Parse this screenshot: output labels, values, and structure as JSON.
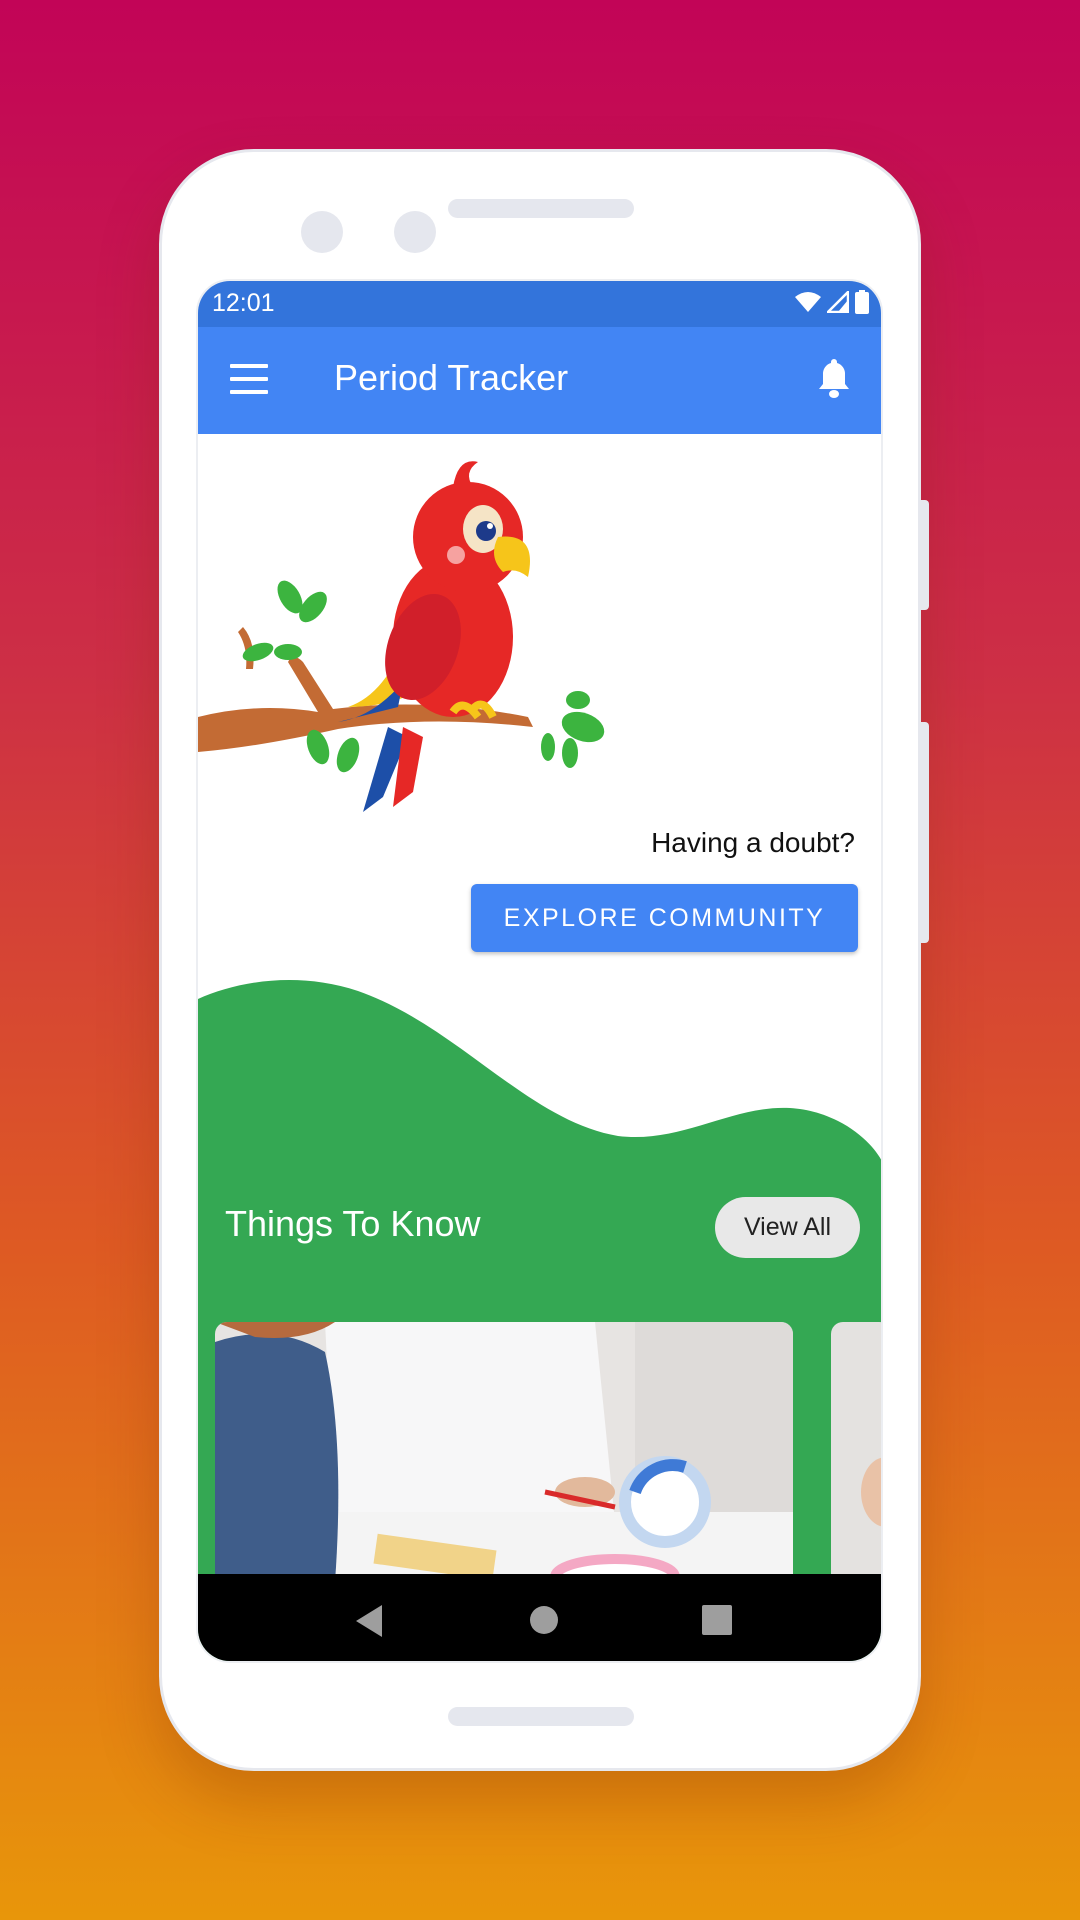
{
  "status_bar": {
    "time": "12:01",
    "icons": [
      "wifi-icon",
      "signal-icon",
      "battery-icon"
    ]
  },
  "app_bar": {
    "title": "Period Tracker",
    "menu_icon": "hamburger-menu-icon",
    "notification_icon": "bell-icon"
  },
  "hero": {
    "illustration": "parrot-on-branch",
    "prompt": "Having a doubt?",
    "button_label": "EXPLORE COMMUNITY"
  },
  "things_to_know": {
    "heading": "Things To Know",
    "view_all_label": "View All",
    "cards": [
      {
        "image": "doctor-explaining-menstrual-cycle-chart"
      },
      {
        "image": "partial-card-image"
      }
    ]
  },
  "nav_bar": {
    "back": "back-icon",
    "home": "home-icon",
    "recents": "recents-icon"
  },
  "colors": {
    "primary": "#4285f4",
    "status_bar": "#3374db",
    "section_green": "#34a853",
    "nav_bar": "#000000"
  }
}
